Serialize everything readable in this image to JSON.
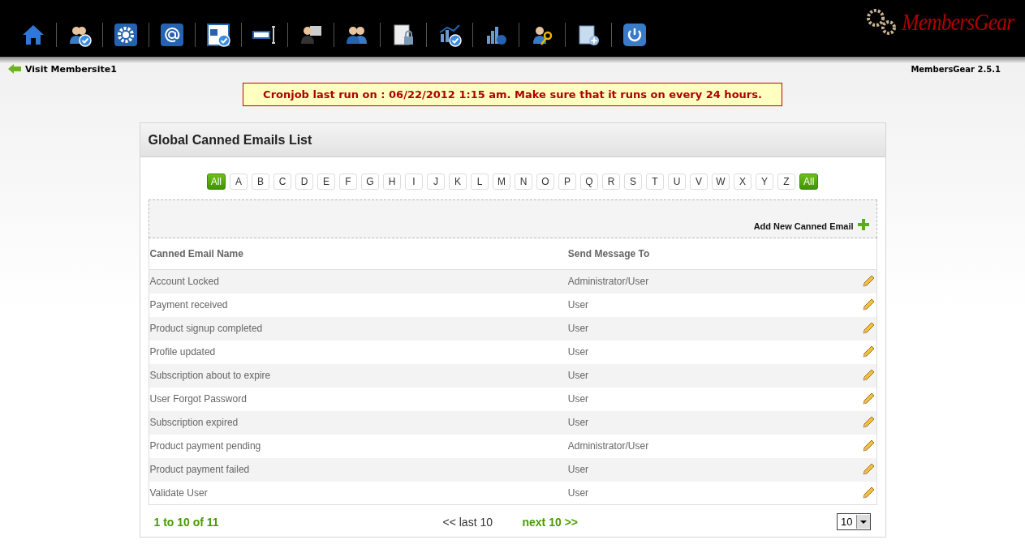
{
  "header": {
    "logo": "MembersGear",
    "version": "MembersGear 2.5.1",
    "back_link": "Visit Membersite1"
  },
  "notice": "Cronjob last run on : 06/22/2012 1:15 am. Make sure that it runs on every 24 hours.",
  "panel": {
    "title": "Global Canned Emails List",
    "letters": [
      {
        "label": "All",
        "selected": true
      },
      {
        "label": "A",
        "selected": false
      },
      {
        "label": "B",
        "selected": false
      },
      {
        "label": "C",
        "selected": false
      },
      {
        "label": "D",
        "selected": false
      },
      {
        "label": "E",
        "selected": false
      },
      {
        "label": "F",
        "selected": false
      },
      {
        "label": "G",
        "selected": false
      },
      {
        "label": "H",
        "selected": false
      },
      {
        "label": "I",
        "selected": false
      },
      {
        "label": "J",
        "selected": false
      },
      {
        "label": "K",
        "selected": false
      },
      {
        "label": "L",
        "selected": false
      },
      {
        "label": "M",
        "selected": false
      },
      {
        "label": "N",
        "selected": false
      },
      {
        "label": "O",
        "selected": false
      },
      {
        "label": "P",
        "selected": false
      },
      {
        "label": "Q",
        "selected": false
      },
      {
        "label": "R",
        "selected": false
      },
      {
        "label": "S",
        "selected": false
      },
      {
        "label": "T",
        "selected": false
      },
      {
        "label": "U",
        "selected": false
      },
      {
        "label": "V",
        "selected": false
      },
      {
        "label": "W",
        "selected": false
      },
      {
        "label": "X",
        "selected": false
      },
      {
        "label": "Y",
        "selected": false
      },
      {
        "label": "Z",
        "selected": false
      },
      {
        "label": "All",
        "selected": true
      }
    ],
    "add_button": "Add New Canned Email",
    "columns": [
      "Canned Email Name",
      "Send Message To"
    ],
    "rows": [
      {
        "name": "Account Locked",
        "send_to": "Administrator/User"
      },
      {
        "name": "Payment received",
        "send_to": "User"
      },
      {
        "name": "Product signup completed",
        "send_to": "User"
      },
      {
        "name": "Profile updated",
        "send_to": "User"
      },
      {
        "name": "Subscription about to expire",
        "send_to": "User"
      },
      {
        "name": "User Forgot Password",
        "send_to": "User"
      },
      {
        "name": "Subscription expired",
        "send_to": "User"
      },
      {
        "name": "Product payment pending",
        "send_to": "Administrator/User"
      },
      {
        "name": "Product payment failed",
        "send_to": "User"
      },
      {
        "name": "Validate User",
        "send_to": "User"
      }
    ],
    "pagination": {
      "range": "1 to 10 of 11",
      "prev": "<< last 10",
      "next": "next 10 >>",
      "page_size": "10"
    }
  }
}
